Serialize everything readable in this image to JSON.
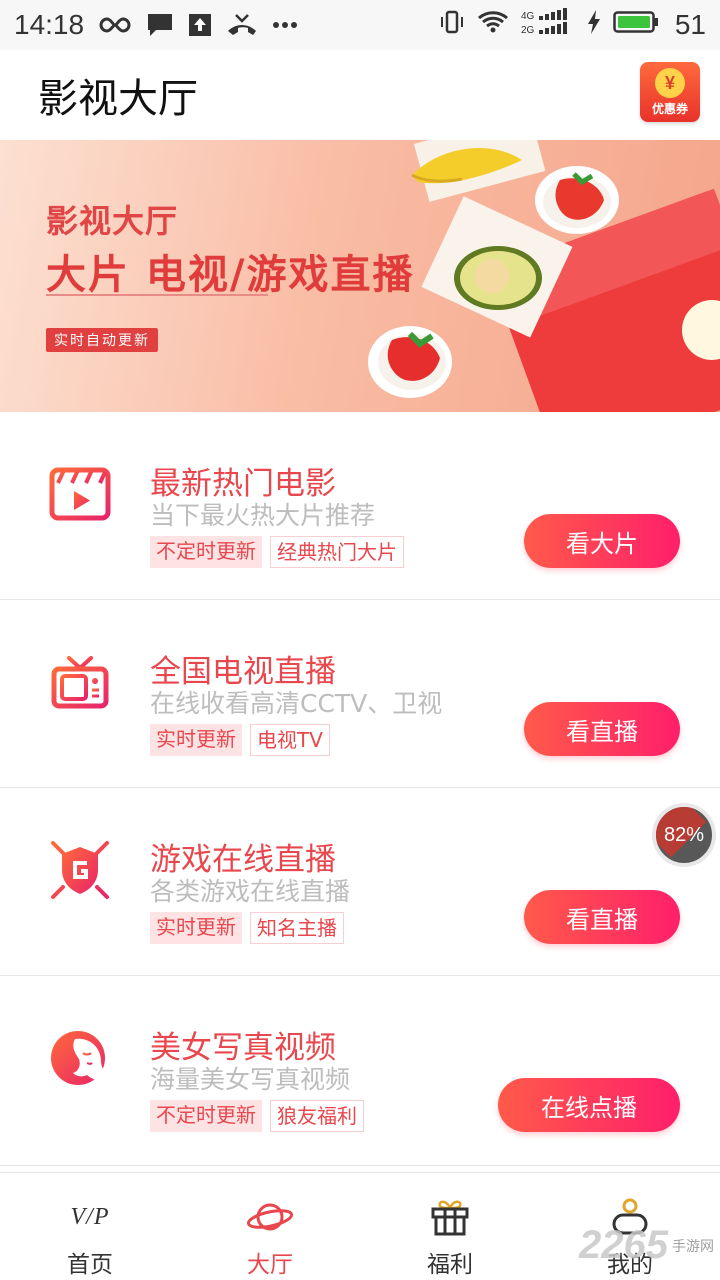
{
  "status_bar": {
    "time": "14:18",
    "battery_level": "51",
    "network_4g": "4G",
    "network_2g": "2G"
  },
  "header": {
    "title": "影视大厅",
    "coupon_label": "优惠券",
    "coupon_symbol": "¥"
  },
  "banner": {
    "subtitle": "影视大厅",
    "main": "大片 电视/游戏直播",
    "tag": "实时自动更新"
  },
  "items": [
    {
      "title": "最新热门电影",
      "desc": "当下最火热大片推荐",
      "tags": [
        "不定时更新",
        "经典热门大片"
      ],
      "button": "看大片",
      "icon": "movie-icon"
    },
    {
      "title": "全国电视直播",
      "desc": "在线收看高清CCTV、卫视",
      "tags": [
        "实时更新",
        "电视TV"
      ],
      "button": "看直播",
      "icon": "tv-icon"
    },
    {
      "title": "游戏在线直播",
      "desc": "各类游戏在线直播",
      "tags": [
        "实时更新",
        "知名主播"
      ],
      "button": "看直播",
      "icon": "game-icon"
    },
    {
      "title": "美女写真视频",
      "desc": "海量美女写真视频",
      "tags": [
        "不定时更新",
        "狼友福利"
      ],
      "button": "在线点播",
      "icon": "beauty-icon"
    }
  ],
  "float_badge": "82%",
  "bottom_nav": [
    {
      "label": "首页",
      "icon": "vip-icon",
      "icon_text": "V/P"
    },
    {
      "label": "大厅",
      "icon": "planet-icon",
      "active": true
    },
    {
      "label": "福利",
      "icon": "gift-icon"
    },
    {
      "label": "我的",
      "icon": "user-icon"
    }
  ],
  "watermark": {
    "number": "2265",
    "text": "手游网"
  },
  "colors": {
    "accent": "#e8474d",
    "button_start": "#ff5a4a",
    "button_end": "#ff1f6b"
  }
}
